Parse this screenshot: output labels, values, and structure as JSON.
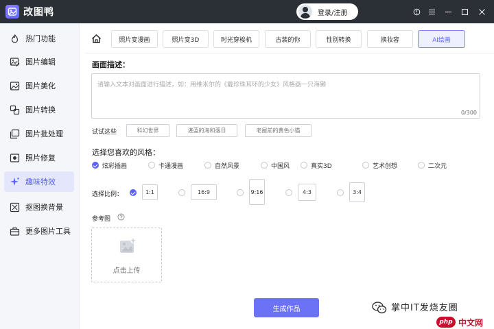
{
  "app": {
    "name": "改图鸭",
    "login_label": "登录/注册"
  },
  "sidebar": {
    "items": [
      {
        "label": "热门功能",
        "icon": "flame-icon"
      },
      {
        "label": "图片编辑",
        "icon": "image-edit-icon"
      },
      {
        "label": "图片美化",
        "icon": "image-beautify-icon"
      },
      {
        "label": "图片转换",
        "icon": "convert-icon"
      },
      {
        "label": "图片批处理",
        "icon": "batch-icon"
      },
      {
        "label": "照片修复",
        "icon": "photo-repair-icon"
      },
      {
        "label": "趣味特效",
        "icon": "sparkle-icon",
        "active": true
      },
      {
        "label": "抠图换背景",
        "icon": "cutout-icon"
      },
      {
        "label": "更多图片工具",
        "icon": "toolbox-icon"
      }
    ]
  },
  "tabs": [
    {
      "label": "照片变漫画"
    },
    {
      "label": "照片变3D"
    },
    {
      "label": "时光穿梭机"
    },
    {
      "label": "古装的你"
    },
    {
      "label": "性别转换"
    },
    {
      "label": "换妆容"
    },
    {
      "label": "AI绘画",
      "active": true
    }
  ],
  "form": {
    "desc_label": "画面描述：",
    "desc_placeholder": "请输入文本对画面进行描述，如：用维米尔的《戴珍珠耳环的少女》风格画一只海獭",
    "desc_count": "0/300",
    "try_label": "试试这些",
    "suggestions": [
      "科幻世界",
      "湛蓝的海和落日",
      "老屋前的黄色小猫"
    ],
    "style_label": "选择您喜欢的风格：",
    "styles": [
      "炫彩插画",
      "卡通漫画",
      "自然风景",
      "中国风",
      "真实3D",
      "艺术创想",
      "二次元"
    ],
    "selected_style": "炫彩插画",
    "ratio_label": "选择比例：",
    "ratios": [
      "1:1",
      "16:9",
      "9:16",
      "4:3",
      "3:4"
    ],
    "selected_ratio": "1:1",
    "ref_label": "参考图",
    "upload_label": "点击上传",
    "generate_label": "生成作品"
  },
  "watermark": {
    "channel": "掌中IT发烧友圈",
    "site_badge": "php",
    "site_name": "中文网"
  },
  "colors": {
    "accent": "#5b63f5",
    "button": "#6b72f5",
    "titlebar": "#2b2f36",
    "sidebar_bg": "#f5f6fa"
  }
}
